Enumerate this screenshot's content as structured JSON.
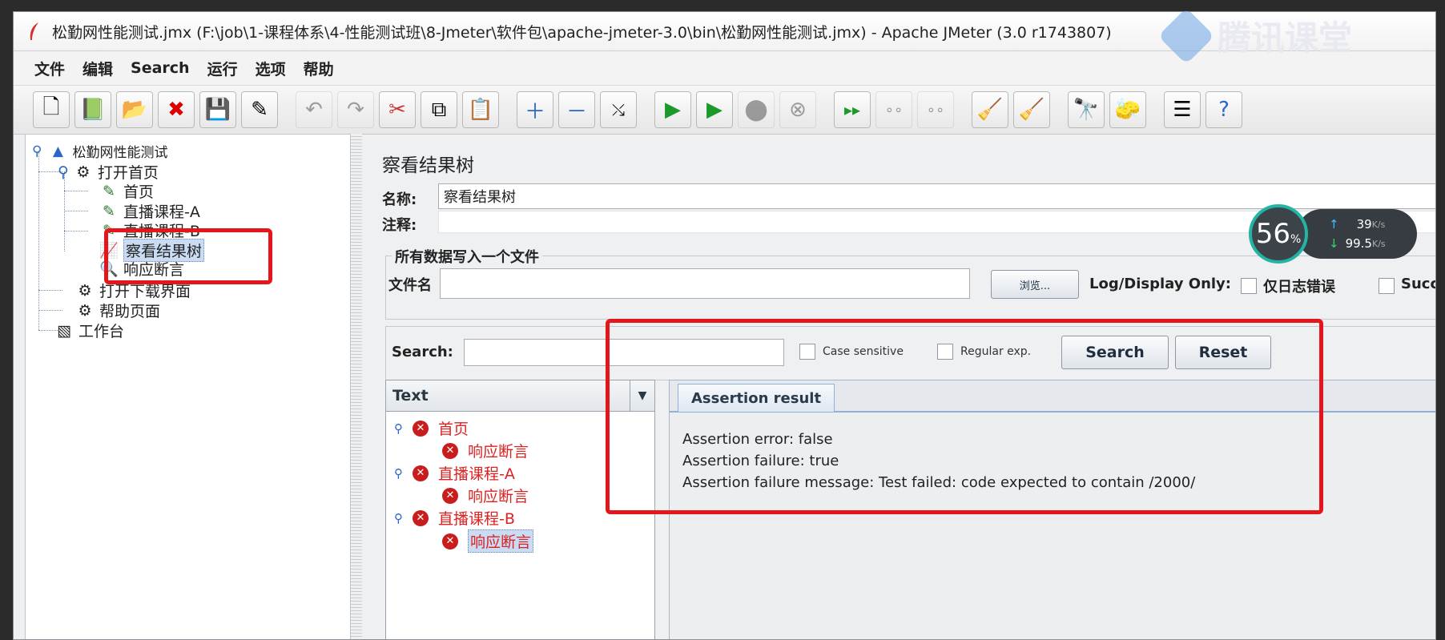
{
  "window": {
    "title": "松勤网性能测试.jmx (F:\\job\\1-课程体系\\4-性能测试班\\8-Jmeter\\软件包\\apache-jmeter-3.0\\bin\\松勤网性能测试.jmx) - Apache JMeter (3.0 r1743807)"
  },
  "menu": [
    "文件",
    "编辑",
    "Search",
    "运行",
    "选项",
    "帮助"
  ],
  "toolbar_icons": [
    "new-icon",
    "templates-icon",
    "open-icon",
    "close-icon",
    "save-icon",
    "save-as-icon",
    "undo-icon",
    "redo-icon",
    "cut-icon",
    "copy-icon",
    "paste-icon",
    "expand-icon",
    "collapse-icon",
    "toggle-icon",
    "start-icon",
    "start-no-pause-icon",
    "stop-icon",
    "shutdown-icon",
    "remote-start-icon",
    "remote-stop-icon",
    "remote-shutdown-icon",
    "clear-icon",
    "clear-all-icon",
    "search-icon",
    "reset-search-icon",
    "function-helper-icon",
    "help-icon"
  ],
  "tree": {
    "root": "松勤网性能测试",
    "group1": "打开首页",
    "item_home": "首页",
    "item_live_a": "直播课程-A",
    "item_live_b": "直播课程-B",
    "item_result_tree": "察看结果树",
    "item_assertion": "响应断言",
    "group2": "打开下载界面",
    "group3": "帮助页面",
    "workbench": "工作台"
  },
  "panel": {
    "heading": "察看结果树",
    "name_label": "名称:",
    "name_value": "察看结果树",
    "comment_label": "注释:",
    "group_title": "所有数据写入一个文件",
    "filename_label": "文件名",
    "browse_label": "浏览...",
    "log_display_label": "Log/Display Only:",
    "errors_only_label": "仅日志错误",
    "successes_label": "Succ"
  },
  "search": {
    "label": "Search:",
    "case_sensitive": "Case sensitive",
    "regular_exp": "Regular exp.",
    "search_button": "Search",
    "reset_button": "Reset"
  },
  "results": {
    "renderer": "Text",
    "rows": [
      {
        "label": "首页",
        "level": 0
      },
      {
        "label": "响应断言",
        "level": 1
      },
      {
        "label": "直播课程-A",
        "level": 0
      },
      {
        "label": "响应断言",
        "level": 1
      },
      {
        "label": "直播课程-B",
        "level": 0
      },
      {
        "label": "响应断言",
        "level": 1
      }
    ]
  },
  "detail": {
    "tab": "Assertion result",
    "line1": "Assertion error: false",
    "line2": "Assertion failure: true",
    "line3": "Assertion failure message: Test failed: code expected to contain /2000/"
  },
  "overlay": {
    "gauge_value": "56",
    "gauge_unit": "%",
    "upload": "39",
    "upload_unit": "K/s",
    "download": "99.5",
    "download_unit": "K/s",
    "watermark": "腾讯课堂"
  },
  "colors": {
    "highlight_red": "#e4161b",
    "error_text": "#d22222",
    "selection": "#c9dcf3"
  }
}
